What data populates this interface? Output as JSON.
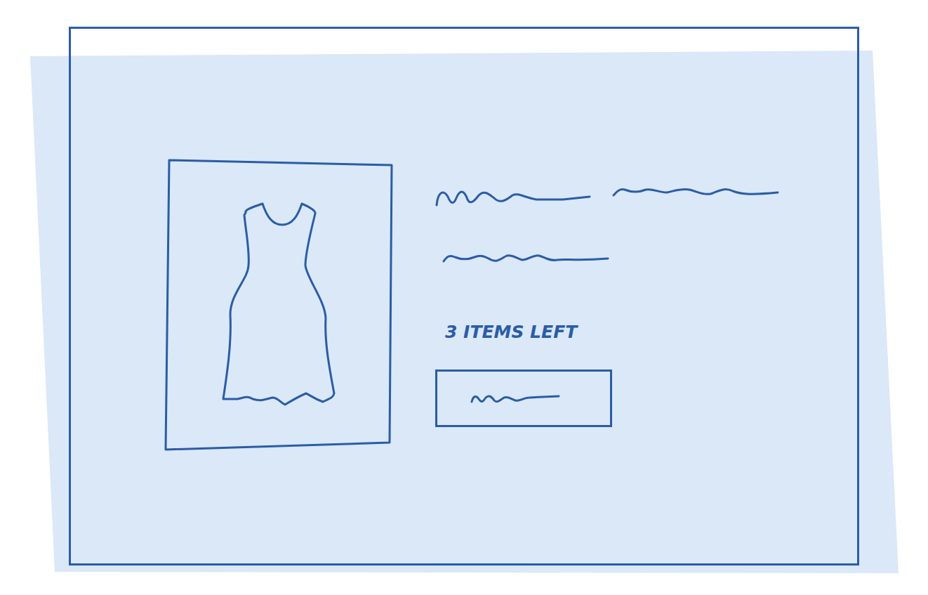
{
  "product": {
    "stock": "3 ITEMS LEFT"
  }
}
